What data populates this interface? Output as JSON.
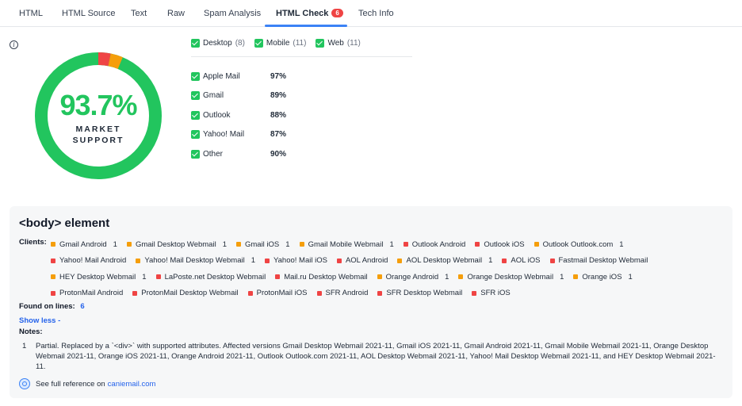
{
  "tabs": [
    {
      "label": "HTML"
    },
    {
      "label": "HTML Source"
    },
    {
      "label": "Text"
    },
    {
      "label": "Raw"
    },
    {
      "label": "Spam Analysis"
    },
    {
      "label": "HTML Check",
      "badge": "6",
      "active": true
    },
    {
      "label": "Tech Info"
    }
  ],
  "summary": {
    "value": "93.7%",
    "label_line1": "MARKET",
    "label_line2": "SUPPORT",
    "support_fraction": 0.937,
    "colors": {
      "support": "#22c55e",
      "partial": "#f59e0b",
      "unsupported": "#ef4444"
    }
  },
  "filters": [
    {
      "label": "Desktop",
      "count": "(8)"
    },
    {
      "label": "Mobile",
      "count": "(11)"
    },
    {
      "label": "Web",
      "count": "(11)"
    }
  ],
  "clients": [
    {
      "name": "Apple Mail",
      "pct": "97%"
    },
    {
      "name": "Gmail",
      "pct": "89%"
    },
    {
      "name": "Outlook",
      "pct": "88%"
    },
    {
      "name": "Yahoo! Mail",
      "pct": "87%"
    },
    {
      "name": "Other",
      "pct": "90%"
    }
  ],
  "panel": {
    "title": "<body> element",
    "clients_label": "Clients:",
    "chip_rows": [
      [
        {
          "name": "Gmail Android",
          "status": "partial",
          "note": "1"
        },
        {
          "name": "Gmail Desktop Webmail",
          "status": "partial",
          "note": "1"
        },
        {
          "name": "Gmail iOS",
          "status": "partial",
          "note": "1"
        },
        {
          "name": "Gmail Mobile Webmail",
          "status": "partial",
          "note": "1"
        },
        {
          "name": "Outlook Android",
          "status": "unsupported",
          "note": ""
        },
        {
          "name": "Outlook iOS",
          "status": "unsupported",
          "note": ""
        },
        {
          "name": "Outlook Outlook.com",
          "status": "partial",
          "note": "1"
        }
      ],
      [
        {
          "name": "Yahoo! Mail Android",
          "status": "unsupported",
          "note": ""
        },
        {
          "name": "Yahoo! Mail Desktop Webmail",
          "status": "partial",
          "note": "1"
        },
        {
          "name": "Yahoo! Mail iOS",
          "status": "unsupported",
          "note": ""
        },
        {
          "name": "AOL Android",
          "status": "unsupported",
          "note": ""
        },
        {
          "name": "AOL Desktop Webmail",
          "status": "partial",
          "note": "1"
        },
        {
          "name": "AOL iOS",
          "status": "unsupported",
          "note": ""
        },
        {
          "name": "Fastmail Desktop Webmail",
          "status": "unsupported",
          "note": ""
        }
      ],
      [
        {
          "name": "HEY Desktop Webmail",
          "status": "partial",
          "note": "1"
        },
        {
          "name": "LaPoste.net Desktop Webmail",
          "status": "unsupported",
          "note": ""
        },
        {
          "name": "Mail.ru Desktop Webmail",
          "status": "unsupported",
          "note": ""
        },
        {
          "name": "Orange Android",
          "status": "partial",
          "note": "1"
        },
        {
          "name": "Orange Desktop Webmail",
          "status": "partial",
          "note": "1"
        },
        {
          "name": "Orange iOS",
          "status": "partial",
          "note": "1"
        }
      ],
      [
        {
          "name": "ProtonMail Android",
          "status": "unsupported",
          "note": ""
        },
        {
          "name": "ProtonMail Desktop Webmail",
          "status": "unsupported",
          "note": ""
        },
        {
          "name": "ProtonMail iOS",
          "status": "unsupported",
          "note": ""
        },
        {
          "name": "SFR Android",
          "status": "unsupported",
          "note": ""
        },
        {
          "name": "SFR Desktop Webmail",
          "status": "unsupported",
          "note": ""
        },
        {
          "name": "SFR iOS",
          "status": "unsupported",
          "note": ""
        }
      ]
    ],
    "found_label": "Found on lines:",
    "found_lines": "6",
    "show_less": "Show less -",
    "notes_label": "Notes:",
    "notes": [
      {
        "num": "1",
        "text": "Partial. Replaced by a `<div>` with supported attributes. Affected versions Gmail Desktop Webmail 2021-11, Gmail iOS 2021-11, Gmail Android 2021-11, Gmail Mobile Webmail 2021-11, Orange Desktop Webmail 2021-11, Orange iOS 2021-11, Orange Android 2021-11, Outlook Outlook.com 2021-11, AOL Desktop Webmail 2021-11, Yahoo! Mail Desktop Webmail 2021-11, and HEY Desktop Webmail 2021-11."
      }
    ],
    "reference_text": "See full reference on",
    "reference_link": "caniemail.com"
  }
}
